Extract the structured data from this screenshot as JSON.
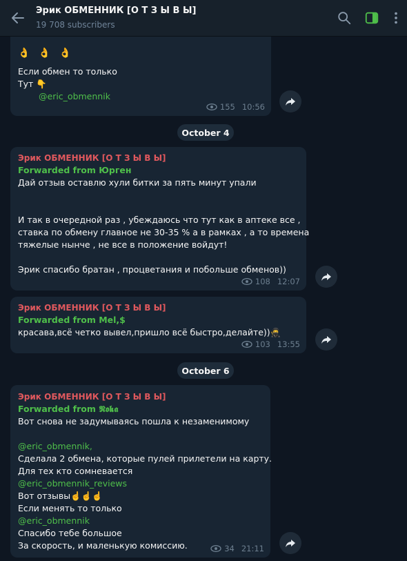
{
  "header": {
    "title": "Эрик ОБМЕННИК [О Т З Ы В Ы]",
    "subscribers": "19 708 subscribers"
  },
  "dates": [
    "October 4",
    "October 6"
  ],
  "messages": [
    {
      "emoji_row": "👌 👌 👌",
      "lines": [
        "Если обмен то только",
        "Тут 👇"
      ],
      "link": "@eric_obmennik",
      "views": "155",
      "time": "10:56"
    },
    {
      "sender": "Эрик ОБМЕННИК [О Т З Ы В Ы]",
      "forwarded": "Forwarded from Юрген",
      "lines": [
        "Дай отзыв оставлю хули битки за пять минут упали",
        "",
        "",
        "И так в очередной раз , убеждаюсь что тут как в аптеке все ,",
        "ставка по обмену главное не 30-35 % а в рамках , а то времена",
        "тяжелые нынче , не все в положение войдут!",
        "",
        "Эрик спасибо братан , процветания и побольше обменов))"
      ],
      "views": "108",
      "time": "12:07"
    },
    {
      "sender": "Эрик ОБМЕННИК [О Т З Ы В Ы]",
      "forwarded": "Forwarded from Mel,$",
      "lines": [
        "красава,всё четко вывел,пришло всё быстро,делайте))🥷"
      ],
      "views": "103",
      "time": "13:55"
    },
    {
      "sender": "Эрик ОБМЕННИК [О Т З Ы В Ы]",
      "forwarded": "Forwarded from 𝕹𝖔𝖐𝖆",
      "lines": [
        "Вот снова не задумываясь пошла к незаменимому",
        "",
        "@eric_obmennik,",
        "Сделала 2 обмена, которые пулей прилетели на карту.",
        "Для тех кто сомневается",
        "@eric_obmennik_reviews",
        "Вот отзывы☝️☝️☝️",
        "Если менять то только",
        "@eric_obmennik",
        "Спасибо тебе большое",
        "За скорость, и маленькую комиссию."
      ],
      "views": "34",
      "time": "21:11"
    }
  ]
}
